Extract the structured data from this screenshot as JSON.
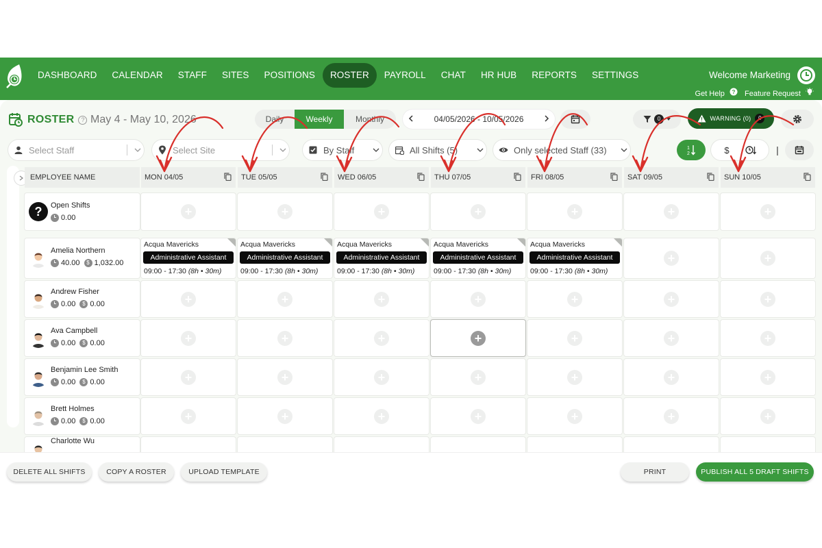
{
  "nav": {
    "items": [
      "DASHBOARD",
      "CALENDAR",
      "STAFF",
      "SITES",
      "POSITIONS",
      "ROSTER",
      "PAYROLL",
      "CHAT",
      "HR HUB",
      "REPORTS",
      "SETTINGS"
    ],
    "active": "ROSTER",
    "welcome": "Welcome Marketing",
    "get_help": "Get Help",
    "feature_request": "Feature Request"
  },
  "page": {
    "title": "ROSTER",
    "date_range": "May 4 - May 10, 2026"
  },
  "view_tabs": [
    "Daily",
    "Weekly",
    "Monthly"
  ],
  "active_view": "Weekly",
  "date_nav": {
    "range": "04/05/2026 - 10/05/2026"
  },
  "filter_count": "0",
  "warning": {
    "label": "WARNING (0)",
    "count": "0"
  },
  "filters": {
    "staff_placeholder": "Select Staff",
    "site_placeholder": "Select Site",
    "group_by": "By Staff",
    "shifts": "All Shifts (5)",
    "visibility": "Only selected Staff (33)"
  },
  "grid": {
    "employee_header": "EMPLOYEE NAME",
    "days": [
      "MON 04/05",
      "TUE 05/05",
      "WED 06/05",
      "THU 07/05",
      "FRI 08/05",
      "SAT 09/05",
      "SUN 10/05"
    ]
  },
  "open_shifts": {
    "name": "Open Shifts",
    "hours": "0.00"
  },
  "employees": [
    {
      "name": "Amelia Northern",
      "hours": "40.00",
      "cost": "1,032.00"
    },
    {
      "name": "Andrew Fisher",
      "hours": "0.00",
      "cost": "0.00"
    },
    {
      "name": "Ava Campbell",
      "hours": "0.00",
      "cost": "0.00"
    },
    {
      "name": "Benjamin Lee Smith",
      "hours": "0.00",
      "cost": "0.00"
    },
    {
      "name": "Brett Holmes",
      "hours": "0.00",
      "cost": "0.00"
    },
    {
      "name": "Charlotte Wu"
    }
  ],
  "shift": {
    "site": "Acqua Mavericks",
    "position": "Administrative Assistant",
    "time": "09:00 - 17:30",
    "duration": "(8h • 30m)"
  },
  "footer": {
    "delete_all": "DELETE ALL SHIFTS",
    "copy_roster": "COPY A ROSTER",
    "upload_template": "UPLOAD TEMPLATE",
    "print": "PRINT",
    "publish": "PUBLISH ALL 5 DRAFT SHIFTS"
  },
  "colors": {
    "brand_green": "#3a9a3e",
    "dark_green": "#1e5e23",
    "annotation_red": "#d9302b"
  }
}
